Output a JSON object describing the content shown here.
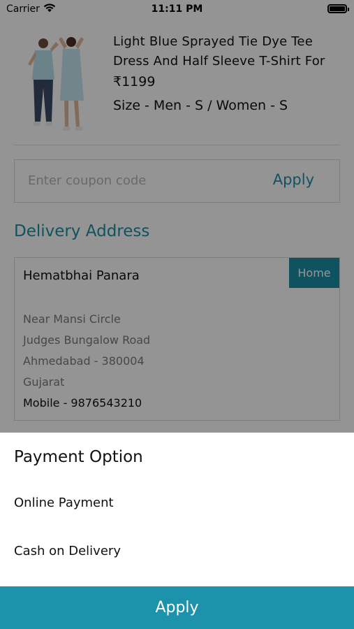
{
  "status_bar": {
    "carrier": "Carrier",
    "time": "11:11 PM"
  },
  "product": {
    "title": "Light Blue Sprayed Tie Dye Tee Dress And Half Sleeve T-Shirt For",
    "price": "₹1199",
    "size": "Size - Men - S / Women - S"
  },
  "coupon": {
    "placeholder": "Enter coupon code",
    "value": "",
    "apply_label": "Apply"
  },
  "delivery": {
    "section_title": "Delivery Address",
    "name": "Hematbhai Panara",
    "tag": "Home",
    "lines": [
      "Near Mansi Circle",
      "Judges Bungalow Road",
      "Ahmedabad - 380004",
      "Gujarat"
    ],
    "mobile": "Mobile - 9876543210"
  },
  "payment_sheet": {
    "title": "Payment Option",
    "options": [
      "Online Payment",
      "Cash on Delivery"
    ]
  },
  "footer": {
    "apply_label": "Apply"
  },
  "colors": {
    "accent": "#1d8fa6",
    "overlay": "rgba(0,0,0,0.42)"
  },
  "icons": [
    "wifi-icon",
    "battery-icon"
  ]
}
